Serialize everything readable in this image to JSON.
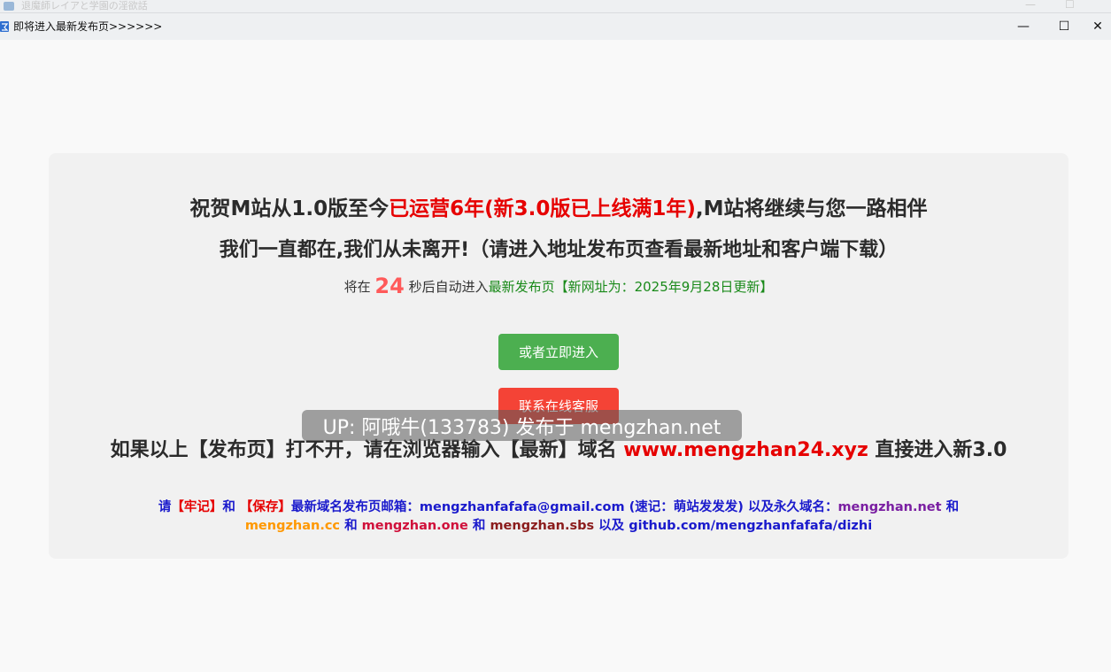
{
  "background_window": {
    "title": "退魔師レイアと学園の淫欲話",
    "controls": [
      "—",
      "☐"
    ]
  },
  "window": {
    "title": "即将进入最新发布页>>>>>>",
    "minimize": "—",
    "maximize": "☐",
    "close": "✕"
  },
  "headline1": {
    "part1": "祝贺M站从1.0版至今",
    "part2": "已运营6年(新3.0版已上线满1年)",
    "part3": ",M站将继续与您一路相伴"
  },
  "headline2": "我们一直都在,我们从未离开!（请进入地址发布页查看最新地址和客户端下载）",
  "countdown": {
    "prefix": "将在",
    "seconds": "24",
    "suffix": "秒后自动进入",
    "link": "最新发布页",
    "note": "【新网址为：2025年9月28日更新】"
  },
  "buttons": {
    "enter": "或者立即进入",
    "support": "联系在线客服"
  },
  "watermark": "UP: 阿哦牛(133783) 发布于 mengzhan.net",
  "fallback": {
    "part1": "如果以上【发布页】打不开，请在浏览器输入【最新】域名",
    "domain": "www.mengzhan24.xyz",
    "part2": "直接进入新3.0"
  },
  "footer": {
    "t1": "请",
    "t2": "【牢记】",
    "t3": "和",
    "t4": "【保存】",
    "t5": "最新域名发布页邮箱：mengzhanfafafa@gmail.com (速记：萌站发发发) 以及永久域名：",
    "d1": "mengzhan.net",
    "t6": "和",
    "d2": "mengzhan.cc",
    "t7": "和",
    "d3": "mengzhan.one",
    "t8": "和",
    "d4": "mengzhan.sbs",
    "t9": "以及 github.com/mengzhanfafafa/dizhi"
  },
  "colors": {
    "accent_red": "#e60000",
    "button_green": "#4caf50",
    "button_red": "#f44336",
    "countdown_number": "#ff5a5a",
    "link_green": "#1a8a1a"
  }
}
